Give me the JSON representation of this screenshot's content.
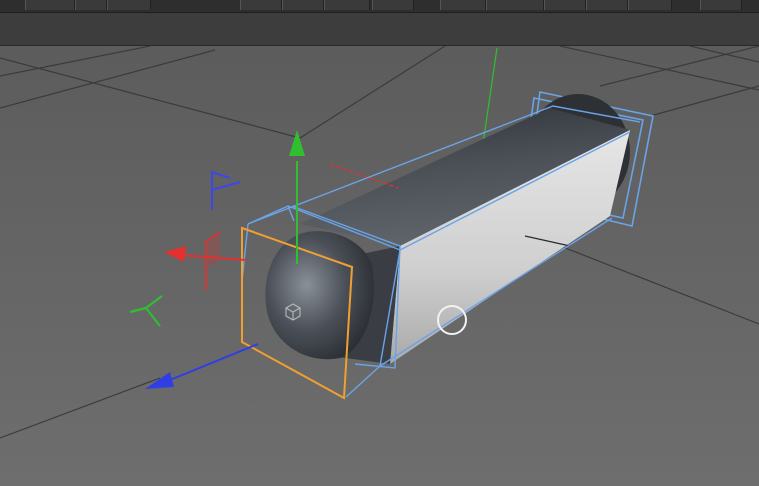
{
  "app": {
    "kind": "3d-viewport",
    "selected_object": "capsule",
    "colors": {
      "viewport_bg_top": "#5a5a5a",
      "viewport_bg_bottom": "#6b6b6b",
      "grid_line": "#3b3b3b",
      "x_axis": "#e53030",
      "y_axis": "#2fbf2f",
      "z_axis": "#2f3ee5",
      "bbox_blue": "#6aa3e6",
      "bbox_orange": "#f0a030",
      "object_dark": "#3b3f45",
      "object_light": "#c9c9c9"
    },
    "icons": {
      "move_x": "arrow-red-icon",
      "move_y": "arrow-green-icon",
      "move_z": "arrow-blue-icon",
      "plane_xy": "plane-handle-blue-icon",
      "plane_yz": "plane-handle-green-icon",
      "plane_xz": "plane-handle-red-icon",
      "pivot": "object-axis-cube-icon",
      "cursor": "cursor-circle-icon"
    }
  }
}
